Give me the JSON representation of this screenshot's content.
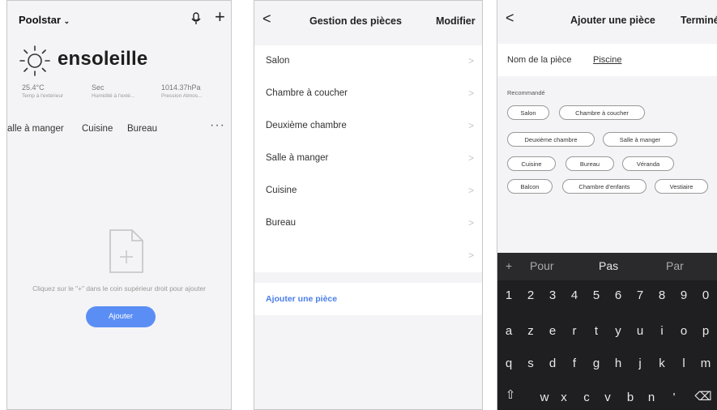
{
  "screen1": {
    "home_name": "Poolstar",
    "weather_title": "ensoleille",
    "stats": [
      {
        "value": "25.4°C",
        "label": "Temp à l'extérieur"
      },
      {
        "value": "Sec",
        "label": "Humidité à l'exté..."
      },
      {
        "value": "1014.37hPa",
        "label": "Pression Atmos..."
      }
    ],
    "tabs": [
      "alle à manger",
      "Cuisine",
      "Bureau"
    ],
    "more": "···",
    "empty_hint": "Cliquez sur le \"+\" dans le coin supérieur droit pour ajouter",
    "add_button": "Ajouter",
    "accent": "#5b8ef5"
  },
  "screen2": {
    "back": "<",
    "title": "Gestion des pièces",
    "edit": "Modifier",
    "rooms": [
      "Salon",
      "Chambre à coucher",
      "Deuxième chambre",
      "Salle à manger",
      "Cuisine",
      "Bureau",
      ""
    ],
    "add_room": "Ajouter une pièce",
    "link_color": "#4a7ee8"
  },
  "screen3": {
    "back": "<",
    "title": "Ajouter une pièce",
    "done": "Terminé",
    "name_label": "Nom de la pièce",
    "name_value": "Piscine",
    "recommended_label": "Recommandé",
    "chips": [
      [
        "Salon",
        "Chambre à coucher"
      ],
      [
        "Deuxième chambre",
        "Salle à manger"
      ],
      [
        "Cuisine",
        "Bureau",
        "Véranda"
      ],
      [
        "Balcon",
        "Chambre d'enfants",
        "Vestiaire"
      ]
    ],
    "keyboard": {
      "suggestions": [
        "+",
        "Pour",
        "Pas",
        "Par"
      ],
      "numbers": [
        "1",
        "2",
        "3",
        "4",
        "5",
        "6",
        "7",
        "8",
        "9",
        "0"
      ],
      "row1": [
        "a",
        "z",
        "e",
        "r",
        "t",
        "y",
        "u",
        "i",
        "o",
        "p"
      ],
      "row2": [
        "q",
        "s",
        "d",
        "f",
        "g",
        "h",
        "j",
        "k",
        "l",
        "m"
      ],
      "row3": [
        "⇧",
        "w",
        "x",
        "c",
        "v",
        "b",
        "n",
        "'",
        "⌫"
      ]
    }
  }
}
